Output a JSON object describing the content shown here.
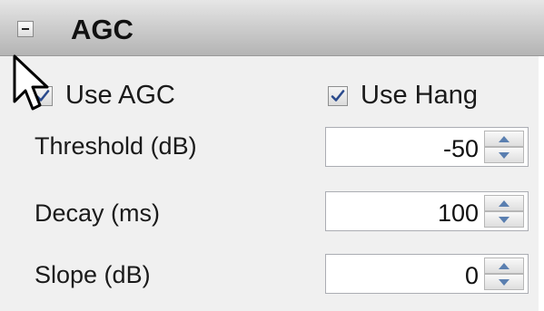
{
  "section": {
    "title": "AGC"
  },
  "checkboxes": {
    "use_agc": {
      "label": "Use AGC",
      "checked": true
    },
    "use_hang": {
      "label": "Use Hang",
      "checked": true
    }
  },
  "fields": [
    {
      "label": "Threshold (dB)",
      "value": "-50"
    },
    {
      "label": "Decay (ms)",
      "value": "100"
    },
    {
      "label": "Slope (dB)",
      "value": "0"
    }
  ],
  "icons": {
    "collapse": "minus-box-icon",
    "check": "checkmark-icon",
    "spin_up": "triangle-up-icon",
    "spin_down": "triangle-down-icon",
    "pointer": "mouse-pointer-icon"
  },
  "colors": {
    "check": "#2a4a8c",
    "spin_arrow": "#5a7fb0"
  }
}
